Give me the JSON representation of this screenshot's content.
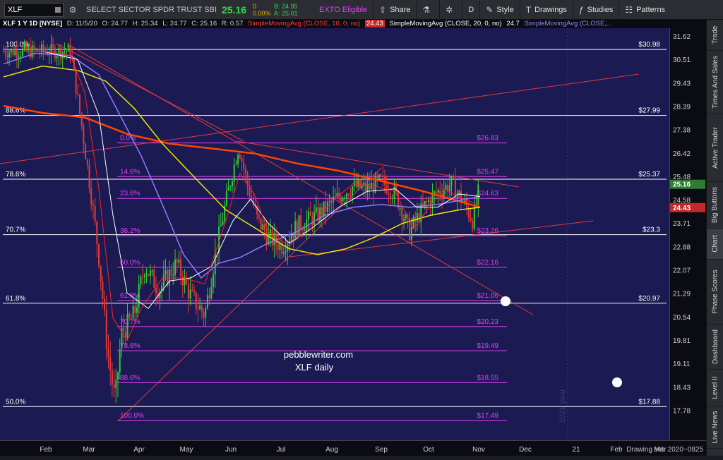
{
  "toolbar": {
    "symbol": "XLF",
    "security_name": "SELECT SECTOR SPDR TRUST SBI IN...",
    "last_price": "25.16",
    "change": "0",
    "change_pct": "0.00%",
    "bid": "B: 24.95",
    "ask": "A: 25.01",
    "exto": "EXTO Eligible",
    "share": "Share",
    "interval": "D",
    "style": "Style",
    "drawings": "Drawings",
    "studies": "Studies",
    "patterns": "Patterns",
    "icons": {
      "gear": "gear-icon",
      "share": "share-icon",
      "flask": "flask-icon",
      "settings": "settings-icon",
      "style": "style-icon",
      "drawings": "drawings-icon",
      "studies": "studies-icon",
      "patterns": "patterns-icon"
    }
  },
  "header": {
    "symbol_label": "XLF 1 Y 1D [NYSE]",
    "date": "D: 11/5/20",
    "open": "O: 24.77",
    "high": "H: 25.34",
    "low": "L: 24.77",
    "close": "C: 25.16",
    "range": "R: 0.57",
    "sma10_label": "SimpleMovingAvg (CLOSE, 10, 0, no)",
    "sma10_value": "24.43",
    "sma20_label": "SimpleMovingAvg (CLOSE, 20, 0, no)",
    "sma20_value": "24.7",
    "sma_next_label": "SimpleMovingAvg (CLOSE,..."
  },
  "price_axis": {
    "ticks": [
      "31.62",
      "30.51",
      "29.43",
      "28.39",
      "27.38",
      "26.42",
      "25.48",
      "24.58",
      "23.71",
      "22.88",
      "22.07",
      "21.29",
      "20.54",
      "19.81",
      "19.11",
      "18.43",
      "17.78"
    ],
    "last_price_tag": "25.16",
    "sma_tag": "24.43",
    "last_price_color": "#2e7d32",
    "sma_tag_color": "#c62828"
  },
  "time_axis": {
    "labels": [
      "Feb",
      "Mar",
      "Apr",
      "May",
      "Jun",
      "Jul",
      "Aug",
      "Sep",
      "Oct",
      "Nov",
      "Dec",
      "21",
      "Feb",
      "Mar"
    ],
    "status": "Drawing set: 2020~0825"
  },
  "right_tabs": [
    "Trade",
    "Times And Sales",
    "Active Trader",
    "Big Buttons",
    "Chart",
    "Phase Scores",
    "Dashboard",
    "Level II",
    "Live News"
  ],
  "chart": {
    "watermark": "2021 year",
    "annotation_line1": "pebblewriter.com",
    "annotation_line2": "XLF daily",
    "long_fib_levels": [
      {
        "pct": "100.0%",
        "price": "$30.98"
      },
      {
        "pct": "88.6%",
        "price": "$27.99"
      },
      {
        "pct": "78.6%",
        "price": "$25.37"
      },
      {
        "pct": "70.7%",
        "price": "$23.3"
      },
      {
        "pct": "61.8%",
        "price": "$20.97"
      },
      {
        "pct": "50.0%",
        "price": "$17.88"
      }
    ],
    "short_fib_levels": [
      {
        "pct": "0.0%",
        "price": "$26.83"
      },
      {
        "pct": "14.6%",
        "price": "$25.47"
      },
      {
        "pct": "23.6%",
        "price": "$24.63"
      },
      {
        "pct": "38.2%",
        "price": "$23.26"
      },
      {
        "pct": "50.0%",
        "price": "$22.16"
      },
      {
        "pct": "61.8%",
        "price": "$21.06"
      },
      {
        "pct": "70.7%",
        "price": "$20.23"
      },
      {
        "pct": "78.6%",
        "price": "$19.49"
      },
      {
        "pct": "88.6%",
        "price": "$18.55"
      },
      {
        "pct": "100.0%",
        "price": "$17.49"
      }
    ],
    "colors": {
      "background": "#1c1a52",
      "fib_long": "#ffffff",
      "fib_short": "#e040fb",
      "sma10": "#ff2020",
      "sma20": "#ffffff",
      "sma50": "#8a7dff",
      "sma100": "#e6e600",
      "sma200": "#ff4500",
      "up_candle": "#33cc33",
      "down_candle": "#e53935"
    }
  }
}
